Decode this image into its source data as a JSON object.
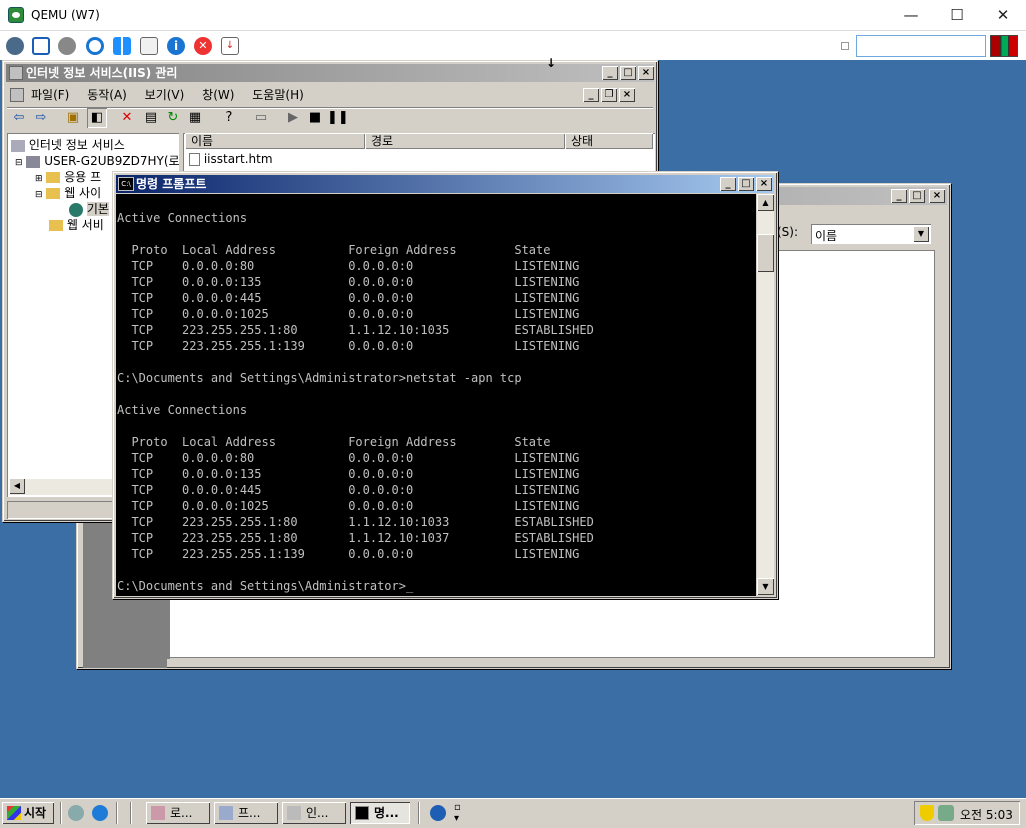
{
  "host": {
    "title": "QEMU (W7)",
    "minimize": "—",
    "maximize": "☐",
    "close": "✕"
  },
  "iis": {
    "title": "인터넷 정보 서비스(IIS) 관리",
    "menu": [
      "파일(F)",
      "동작(A)",
      "보기(V)",
      "창(W)",
      "도움말(H)"
    ],
    "tree": {
      "root": "인터넷 정보 서비스",
      "computer": "USER-G2UB9ZD7HY(로",
      "app_pools": "응용 프",
      "web_sites": "웹 사이",
      "default_site": "기본",
      "web_ext": "웹 서비"
    },
    "columns": [
      "이름",
      "경로",
      "상태"
    ],
    "rows": [
      {
        "name": "iisstart.htm"
      }
    ]
  },
  "back_window": {
    "sort_label": "(S):",
    "sort_value": "이름"
  },
  "cmd": {
    "title": "명령 프롬프트",
    "lines": [
      "",
      "Active Connections",
      "",
      "  Proto  Local Address          Foreign Address        State",
      "  TCP    0.0.0.0:80             0.0.0.0:0              LISTENING",
      "  TCP    0.0.0.0:135            0.0.0.0:0              LISTENING",
      "  TCP    0.0.0.0:445            0.0.0.0:0              LISTENING",
      "  TCP    0.0.0.0:1025           0.0.0.0:0              LISTENING",
      "  TCP    223.255.255.1:80       1.1.12.10:1035         ESTABLISHED",
      "  TCP    223.255.255.1:139      0.0.0.0:0              LISTENING",
      "",
      "C:\\Documents and Settings\\Administrator>netstat -apn tcp",
      "",
      "Active Connections",
      "",
      "  Proto  Local Address          Foreign Address        State",
      "  TCP    0.0.0.0:80             0.0.0.0:0              LISTENING",
      "  TCP    0.0.0.0:135            0.0.0.0:0              LISTENING",
      "  TCP    0.0.0.0:445            0.0.0.0:0              LISTENING",
      "  TCP    0.0.0.0:1025           0.0.0.0:0              LISTENING",
      "  TCP    223.255.255.1:80       1.1.12.10:1033         ESTABLISHED",
      "  TCP    223.255.255.1:80       1.1.12.10:1037         ESTABLISHED",
      "  TCP    223.255.255.1:139      0.0.0.0:0              LISTENING",
      "",
      "C:\\Documents and Settings\\Administrator>_"
    ]
  },
  "taskbar": {
    "start": "시작",
    "tasks": [
      "로...",
      "프...",
      "인...",
      "명..."
    ],
    "clock": "오전 5:03"
  }
}
